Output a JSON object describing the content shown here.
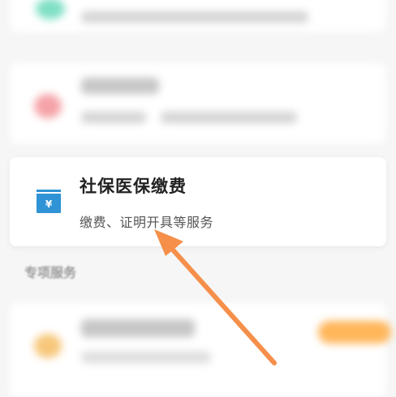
{
  "main_card": {
    "title": "社保医保缴费",
    "subtitle": "缴费、证明开具等服务",
    "icon": "wallet-icon"
  },
  "section": {
    "title": "专项服务"
  },
  "colors": {
    "icon_blue": "#2f93d6",
    "arrow_orange": "#f58f4a",
    "blurred_green": "#7fe0c5",
    "blurred_red": "#f5a3a8",
    "blurred_yellow": "#f7c77a",
    "blurred_orange_button": "#ffb65a"
  }
}
